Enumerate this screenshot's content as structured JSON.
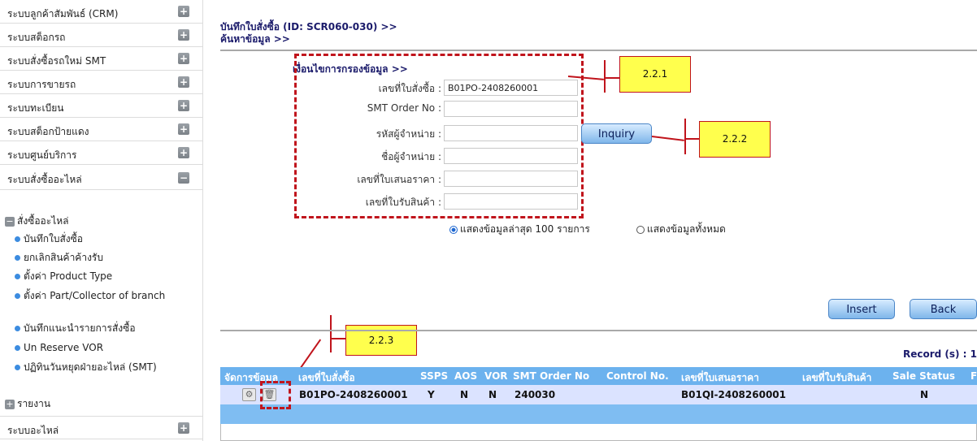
{
  "sidebar": {
    "items": [
      {
        "label": "ระบบลูกค้าสัมพันธ์ (CRM)",
        "toggle": "+"
      },
      {
        "label": "ระบบสต็อกรถ",
        "toggle": "+"
      },
      {
        "label": "ระบบสั่งซื้อรถใหม่ SMT",
        "toggle": "+"
      },
      {
        "label": "ระบบการขายรถ",
        "toggle": "+"
      },
      {
        "label": "ระบบทะเบียน",
        "toggle": "+"
      },
      {
        "label": "ระบบสต็อกป้ายแดง",
        "toggle": "+"
      },
      {
        "label": "ระบบศูนย์บริการ",
        "toggle": "+"
      },
      {
        "label": "ระบบสั่งซื้ออะไหล่",
        "toggle": "−"
      }
    ],
    "sub_group": {
      "label": "สั่งซื้ออะไหล่",
      "toggle": "−"
    },
    "sub_items": [
      "บันทึกใบสั่งซื้อ",
      "ยกเลิกสินค้าค้างรับ",
      "ตั้งค่า Product Type",
      "ตั้งค่า Part/Collector of branch",
      "บันทึกแนะนำรายการสั่งซื้อ",
      "Un Reserve VOR",
      "ปฏิทินวันหยุดฝ่ายอะไหล่ (SMT)"
    ],
    "report": {
      "label": "รายงาน",
      "toggle": "+"
    },
    "last_item": {
      "label": "ระบบอะไหล่",
      "toggle": "+"
    }
  },
  "header": {
    "title": "บันทึกใบสั่งซื้อ (ID: SCR060-030) >>",
    "subtitle": "ค้นหาข้อมูล >>"
  },
  "filter": {
    "heading": "เงื่อนไขการกรองข้อมูล >>",
    "fields": [
      {
        "label": "เลขที่ใบสั่งซื้อ :",
        "value": "B01PO-2408260001"
      },
      {
        "label": "SMT Order No :",
        "value": ""
      },
      {
        "label": "รหัสผู้จำหน่าย :",
        "value": ""
      },
      {
        "label": "ชื่อผู้จำหน่าย :",
        "value": ""
      },
      {
        "label": "เลขที่ใบเสนอราคา :",
        "value": ""
      },
      {
        "label": "เลขที่ใบรับสินค้า :",
        "value": ""
      }
    ],
    "inquiry_label": "Inquiry",
    "radio_latest": "แสดงข้อมูลล่าสุด 100 รายการ",
    "radio_all": "แสดงข้อมูลทั้งหมด"
  },
  "actions": {
    "insert_label": "Insert",
    "back_label": "Back"
  },
  "callouts": {
    "c1": "2.2.1",
    "c2": "2.2.2",
    "c3": "2.2.3"
  },
  "table": {
    "record_text": "Record (s) : 1",
    "headers": [
      "จัดการข้อมูล",
      "เลขที่ใบสั่งซื้อ",
      "SSPS",
      "AOS",
      "VOR",
      "SMT Order No",
      "Control No.",
      "เลขที่ใบเสนอราคา",
      "เลขที่ใบรับสินค้า",
      "Sale Status",
      "F"
    ],
    "rows": [
      {
        "po": "B01PO-2408260001",
        "ssps": "Y",
        "aos": "N",
        "vor": "N",
        "smt": "240030",
        "control": "",
        "quote": "B01QI-2408260001",
        "receipt": "",
        "sale_status": "N"
      }
    ]
  },
  "colors": {
    "header_blue": "#6cb2ee",
    "highlight_red": "#c0141c",
    "callout_yellow": "#ffff4d"
  }
}
